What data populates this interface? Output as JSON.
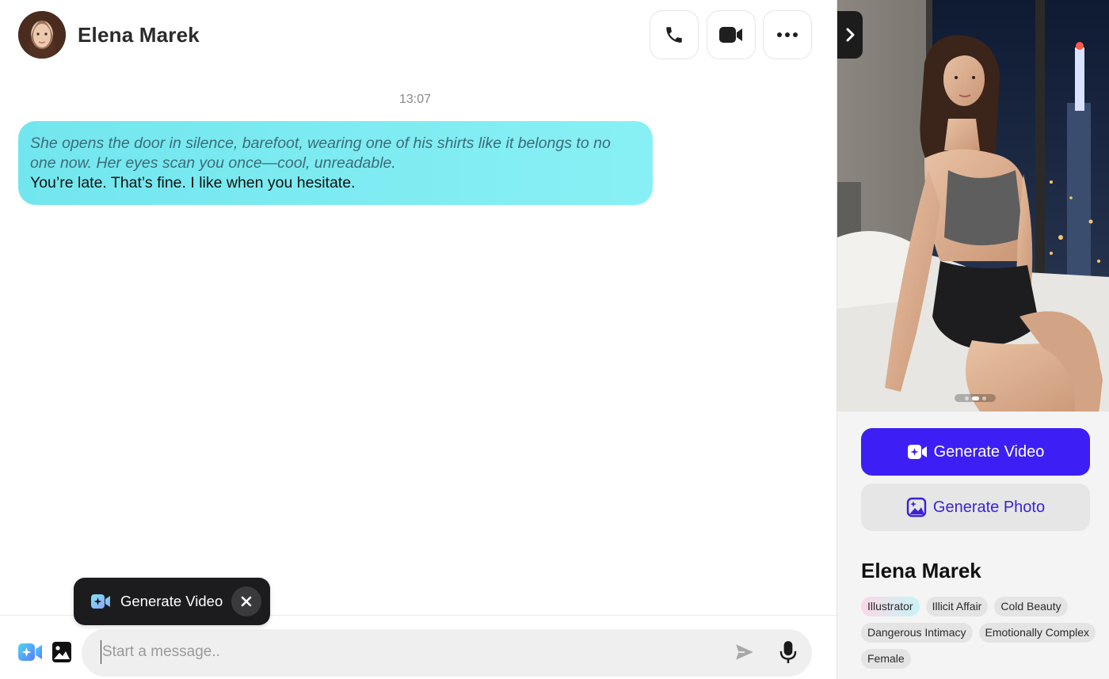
{
  "header": {
    "contact_name": "Elena Marek",
    "call_icon": "phone-icon",
    "video_icon": "video-camera-icon",
    "more_icon": "more-horizontal-icon"
  },
  "conversation": {
    "timestamp": "13:07",
    "messages": [
      {
        "sender": "Elena Marek",
        "action": "She opens the door in silence, barefoot, wearing one of his shirts like it belongs to no one now. Her eyes scan you once—cool, unreadable.",
        "text": "You’re late. That’s fine. I like when you hesitate."
      }
    ]
  },
  "generate_popup": {
    "label": "Generate Video",
    "close_icon": "close-icon"
  },
  "composer": {
    "placeholder": "Start a message..",
    "value": "",
    "video_icon": "video-sparkle-icon",
    "image_icon": "image-icon",
    "send_icon": "send-icon",
    "mic_icon": "microphone-icon"
  },
  "profile": {
    "name": "Elena Marek",
    "photo_count": 3,
    "photo_active_index": 1,
    "generate_video_label": "Generate Video",
    "generate_photo_label": "Generate Photo",
    "tags": [
      "Illustrator",
      "Illicit Affair",
      "Cold Beauty",
      "Dangerous Intimacy",
      "Emotionally Complex",
      "Female"
    ]
  },
  "colors": {
    "bubble_start": "#72e6ee",
    "bubble_end": "#88f0f5",
    "primary_button": "#3d1ff5",
    "secondary_text": "#3b22d6",
    "popup_bg": "#1c1c1e"
  }
}
